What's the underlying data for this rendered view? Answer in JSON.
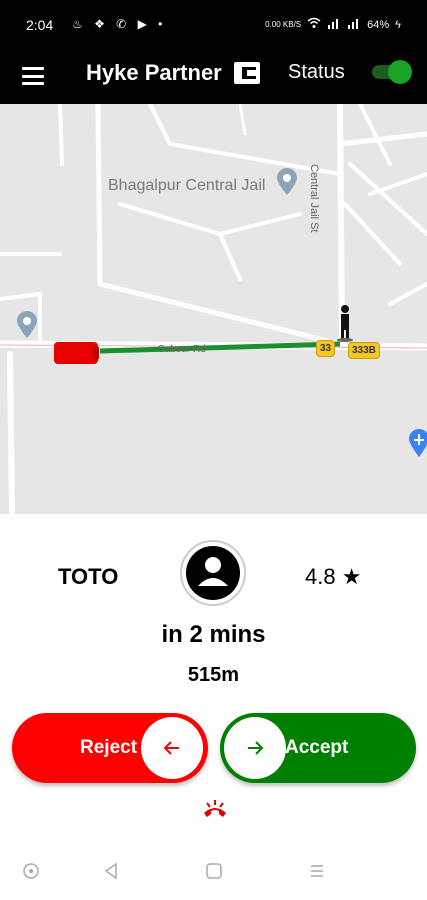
{
  "status_bar": {
    "time": "2:04",
    "network_speed": "0.00 KB/S",
    "battery": "64%"
  },
  "app_bar": {
    "title": "Hyke Partner",
    "status_label": "Status",
    "status_on": true
  },
  "map": {
    "place_label": "Bhagalpur Central Jail",
    "road_label": "Sabour Rd",
    "road_label_vertical": "Central Jail St",
    "shield_1": "33",
    "shield_2": "333B",
    "route_color": "#1a8f2e",
    "vehicle_color": "#e60000"
  },
  "ride": {
    "vehicle_name": "TOTO",
    "rating": "4.8 ★",
    "eta": "in 2 mins",
    "distance": "515m"
  },
  "actions": {
    "reject_label": "Reject",
    "accept_label": "Accept",
    "reject_color": "#ff0000",
    "accept_color": "#008000"
  },
  "icons": [
    "menu-icon",
    "wallet-icon",
    "person-icon",
    "arrow-left-icon",
    "arrow-right-icon",
    "hangup-icon",
    "place-pin-icon",
    "airport-icon",
    "walker-icon"
  ]
}
